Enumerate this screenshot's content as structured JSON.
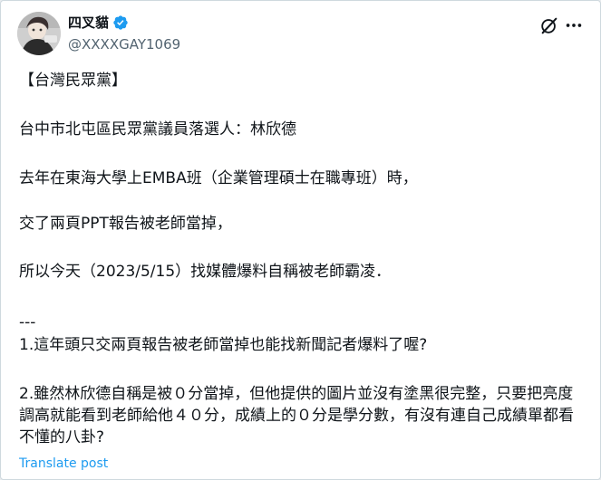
{
  "author": {
    "display_name": "四叉貓",
    "handle": "@XXXXGAY1069",
    "verified_icon": "verified-badge-icon",
    "verified_color": "#1d9bf0"
  },
  "actions": {
    "grok_icon": "grok-icon",
    "more_icon": "more-icon"
  },
  "post": {
    "paragraphs": [
      "【台灣民眾黨】",
      "台中市北屯區民眾黨議員落選人：林欣德",
      "去年在東海大學上EMBA班（企業管理碩士在職專班）時，",
      "交了兩頁PPT報告被老師當掉，",
      "所以今天（2023/5/15）找媒體爆料自稱被老師霸凌．",
      "---",
      "1.這年頭只交兩頁報告被老師當掉也能找新聞記者爆料了喔?",
      "2.雖然林欣德自稱是被０分當掉，但他提供的圖片並沒有塗黑很完整，只要把亮度調高就能看到老師給他４０分，成績上的０分是學分數，有沒有連自己成績單都看不懂的八卦?"
    ]
  },
  "translate_label": "Translate post",
  "colors": {
    "text": "#0f1419",
    "secondary": "#536471",
    "link": "#1d9bf0"
  }
}
